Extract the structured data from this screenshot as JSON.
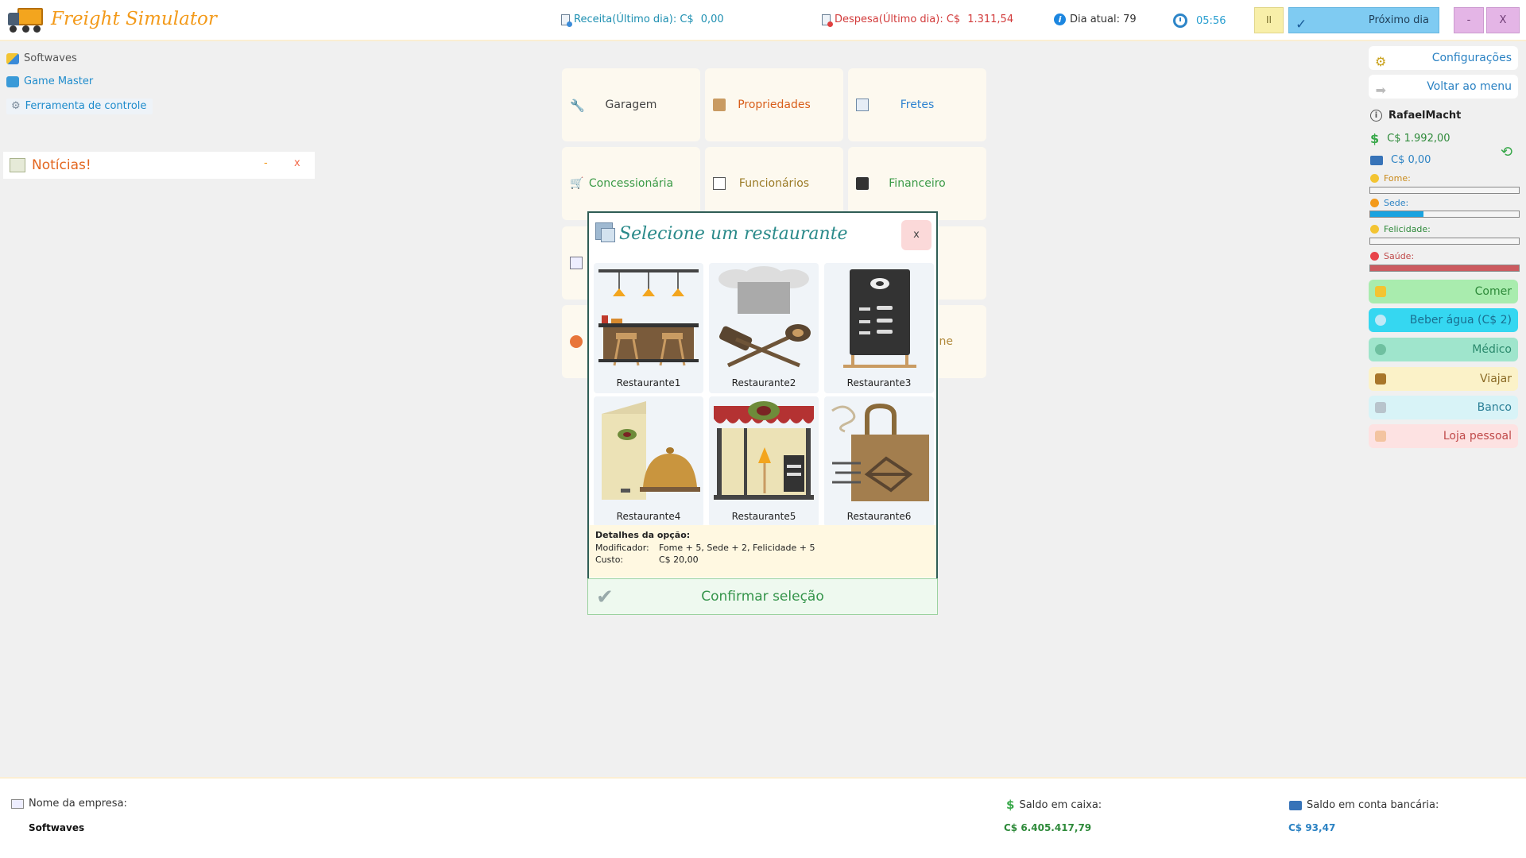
{
  "app": {
    "title": "Freight Simulator"
  },
  "topbar": {
    "revenue_label": "Receita(Último dia): C$",
    "revenue_value": "0,00",
    "expense_label": "Despesa(Último dia): C$",
    "expense_value": "1.311,54",
    "day_label": "Dia atual: 79",
    "time": "05:56",
    "pause_label": "II",
    "next_day_label": "Próximo dia",
    "minimize_label": "-",
    "close_label": "X"
  },
  "left": {
    "softwaves": "Softwaves",
    "game_master": "Game Master",
    "control_tool": "Ferramenta de controle",
    "news_title": "Notícias!",
    "news_min": "-",
    "news_close": "x"
  },
  "menu": {
    "garage": "Garagem",
    "properties": "Propriedades",
    "freights": "Fretes",
    "dealership": "Concessionária",
    "employees": "Funcionários",
    "financial": "Financeiro",
    "partial_row4": "ne"
  },
  "modal": {
    "title": "Selecione um restaurante",
    "close_label": "x",
    "options": [
      {
        "label": "Restaurante1"
      },
      {
        "label": "Restaurante2"
      },
      {
        "label": "Restaurante3"
      },
      {
        "label": "Restaurante4"
      },
      {
        "label": "Restaurante5"
      },
      {
        "label": "Restaurante6"
      }
    ],
    "details_title": "Detalhes da opção:",
    "modifier_label": "Modificador:",
    "modifier_value": "Fome + 5, Sede + 2, Felicidade + 5",
    "cost_label": "Custo:",
    "cost_value": "C$ 20,00",
    "confirm_label": "Confirmar seleção"
  },
  "right": {
    "settings": "Configurações",
    "back_to_menu": "Voltar ao menu",
    "username": "RafaelMacht",
    "cash": "C$  1.992,00",
    "card": "C$  0,00",
    "needs": [
      {
        "label": "Fome:",
        "fill": 0,
        "color": "#f3c432",
        "fill_color": "#f3c432"
      },
      {
        "label": "Sede:",
        "fill": 0.36,
        "color": "#f39a1a",
        "fill_color": "#1aa3e0"
      },
      {
        "label": "Felicidade:",
        "fill": 0,
        "color": "#f3c432",
        "fill_color": "#f3c432"
      },
      {
        "label": "Saúde:",
        "fill": 1,
        "color": "#e8434a",
        "fill_color": "#cc5a5f"
      }
    ],
    "eat": "Comer",
    "drink_water": "Beber água (C$ 2)",
    "doctor": "Médico",
    "travel": "Viajar",
    "bank": "Banco",
    "personal_shop": "Loja pessoal"
  },
  "bottom": {
    "company_label": "Nome da empresa:",
    "company_name": "Softwaves",
    "cash_label": "Saldo em caixa:",
    "cash_value": "C$  6.405.417,79",
    "bank_label": "Saldo em conta bancária:",
    "bank_value": "C$  93,47"
  }
}
